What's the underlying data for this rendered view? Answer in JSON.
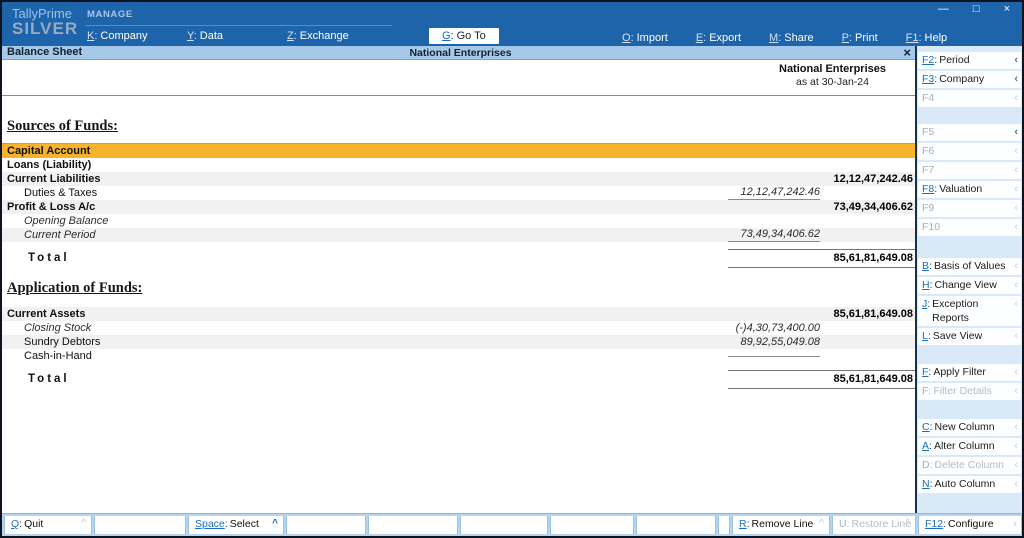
{
  "app": {
    "brand": "TallyPrime",
    "edition": "SILVER"
  },
  "icons": {
    "minimize": "—",
    "maximize_restore": "□",
    "close": "×",
    "report_close": "×",
    "caret": "^",
    "chevron": "‹"
  },
  "colors": {
    "titlebar_blue": "#1e64ab",
    "report_bar_blue": "#a6c9e9",
    "selection_yellow": "#f7b32b",
    "key_blue": "#1a6fbd"
  },
  "titlebar": {
    "manage_label": "MANAGE",
    "menus_left": [
      {
        "key": "K",
        "label": "Company"
      },
      {
        "key": "Y",
        "label": "Data"
      },
      {
        "key": "Z",
        "label": "Exchange"
      }
    ],
    "goto": {
      "key": "G",
      "label": "Go To"
    },
    "menus_right": [
      {
        "key": "O",
        "label": "Import"
      },
      {
        "key": "E",
        "label": "Export"
      },
      {
        "key": "M",
        "label": "Share"
      },
      {
        "key": "P",
        "label": "Print"
      },
      {
        "key": "F1",
        "label": "Help"
      }
    ]
  },
  "report_bar": {
    "title": "Balance Sheet",
    "company": "National Enterprises"
  },
  "report": {
    "company": "National Enterprises",
    "as_at": "as at 30-Jan-24",
    "sections": [
      {
        "title": "Sources of Funds:",
        "rows": [
          {
            "name": "Capital Account",
            "emphasis": "bold",
            "selected": true,
            "inner": "",
            "outer": ""
          },
          {
            "name": "Loans (Liability)",
            "emphasis": "bold",
            "inner": "",
            "outer": ""
          },
          {
            "name": "Current Liabilities",
            "emphasis": "bold",
            "stripe": true,
            "inner": "",
            "outer": "12,12,47,242.46"
          },
          {
            "name": "Duties & Taxes",
            "indent": true,
            "inner": "12,12,47,242.46",
            "outer": "",
            "inner_line": true
          },
          {
            "name": "Profit & Loss A/c",
            "emphasis": "bold",
            "stripe": true,
            "inner": "",
            "outer": "73,49,34,406.62"
          },
          {
            "name": "Opening Balance",
            "indent": true,
            "emphasis": "italic",
            "inner": "",
            "outer": ""
          },
          {
            "name": "Current Period",
            "indent": true,
            "emphasis": "italic",
            "stripe": true,
            "inner": "73,49,34,406.62",
            "outer": "",
            "inner_line": true
          }
        ],
        "total": {
          "label": "Total",
          "amount": "85,61,81,649.08"
        }
      },
      {
        "title": "Application of Funds:",
        "rows": [
          {
            "name": "Current Assets",
            "emphasis": "bold",
            "stripe": true,
            "inner": "",
            "outer": "85,61,81,649.08"
          },
          {
            "name": "Closing Stock",
            "indent": true,
            "emphasis": "italic",
            "inner": "(-)4,30,73,400.00",
            "outer": ""
          },
          {
            "name": "Sundry Debtors",
            "indent": true,
            "stripe": true,
            "inner": "89,92,55,049.08",
            "outer": ""
          },
          {
            "name": "Cash-in-Hand",
            "indent": true,
            "inner": "",
            "outer": "",
            "inner_line": true
          }
        ],
        "total": {
          "label": "Total",
          "amount": "85,61,81,649.08"
        }
      }
    ]
  },
  "sidebar": {
    "groups": [
      [
        {
          "key": "F2",
          "label": "Period",
          "enabled": true,
          "chevron_dark": true
        },
        {
          "key": "F3",
          "label": "Company",
          "enabled": true,
          "chevron_dark": true
        },
        {
          "key": "F4",
          "label": "",
          "enabled": false
        }
      ],
      [
        {
          "key": "F5",
          "label": "",
          "enabled": false,
          "chevron_dark": true
        },
        {
          "key": "F6",
          "label": "",
          "enabled": false
        },
        {
          "key": "F7",
          "label": "",
          "enabled": false
        },
        {
          "key": "F8",
          "label": "Valuation",
          "enabled": true
        },
        {
          "key": "F9",
          "label": "",
          "enabled": false
        },
        {
          "key": "F10",
          "label": "",
          "enabled": false
        }
      ],
      [
        {
          "key": "B",
          "label": "Basis of Values",
          "enabled": true
        },
        {
          "key": "H",
          "label": "Change View",
          "enabled": true
        },
        {
          "key": "J",
          "label": "Exception Reports",
          "enabled": true,
          "wrap": true
        },
        {
          "key": "L",
          "label": "Save View",
          "enabled": true
        }
      ],
      [
        {
          "key": "F",
          "label": "Apply Filter",
          "enabled": true
        },
        {
          "key": "F",
          "label": "Filter Details",
          "enabled": false
        }
      ],
      [
        {
          "key": "C",
          "label": "New Column",
          "enabled": true
        },
        {
          "key": "A",
          "label": "Alter Column",
          "enabled": true
        },
        {
          "key": "D",
          "label": "Delete Column",
          "enabled": false
        },
        {
          "key": "N",
          "label": "Auto Column",
          "enabled": true
        }
      ]
    ]
  },
  "bottombar": {
    "segments": [
      {
        "key": "Q",
        "label": "Quit",
        "caret": true,
        "enabled": true
      },
      {
        "empty": true
      },
      {
        "key": "Space",
        "label": "Select",
        "caret": true,
        "caret_blue": true,
        "enabled": true
      },
      {
        "empty": true
      },
      {
        "empty": true
      },
      {
        "empty": true
      },
      {
        "empty": true
      },
      {
        "empty": true
      },
      {
        "empty": true
      },
      {
        "key": "R",
        "label": "Remove Line",
        "caret": true,
        "enabled": true
      },
      {
        "key": "U",
        "label": "Restore Line",
        "caret": true,
        "enabled": false
      },
      {
        "key": "F12",
        "label": "Configure",
        "chevron": true,
        "enabled": true
      }
    ]
  }
}
